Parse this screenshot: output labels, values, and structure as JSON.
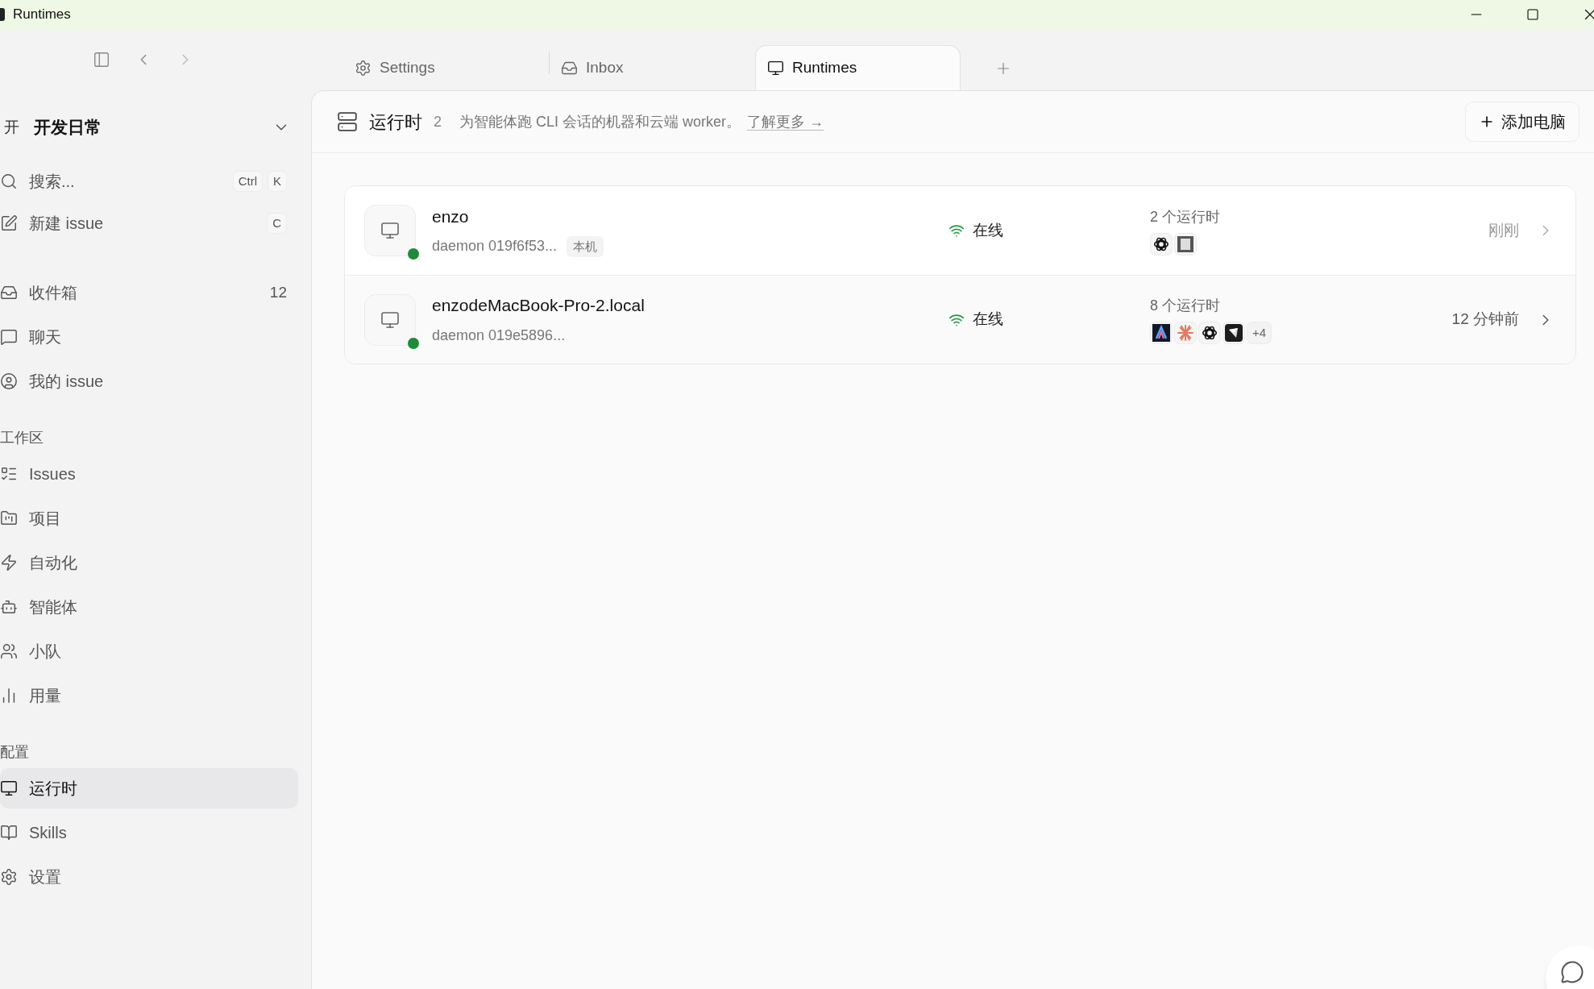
{
  "window": {
    "title": "Runtimes"
  },
  "tabs": [
    {
      "label": "Settings",
      "selected": false
    },
    {
      "label": "Inbox",
      "selected": false
    },
    {
      "label": "Runtimes",
      "selected": true
    }
  ],
  "sidebar": {
    "workspace": {
      "initial": "开",
      "name": "开发日常"
    },
    "quick": [
      {
        "label": "搜索...",
        "keys": [
          "Ctrl",
          "K"
        ]
      },
      {
        "label": "新建 issue",
        "keys": [
          "C"
        ]
      }
    ],
    "personal": [
      {
        "label": "收件箱",
        "count": "12",
        "selected": false
      },
      {
        "label": "聊天",
        "selected": false
      },
      {
        "label": "我的 issue",
        "selected": false
      }
    ],
    "sections": [
      {
        "title": "工作区",
        "items": [
          {
            "label": "Issues",
            "selected": false
          },
          {
            "label": "项目",
            "selected": false
          },
          {
            "label": "自动化",
            "selected": false
          },
          {
            "label": "智能体",
            "selected": false
          },
          {
            "label": "小队",
            "selected": false
          },
          {
            "label": "用量",
            "selected": false
          }
        ]
      },
      {
        "title": "配置",
        "items": [
          {
            "label": "运行时",
            "selected": true
          },
          {
            "label": "Skills",
            "selected": false
          },
          {
            "label": "设置",
            "selected": false
          }
        ]
      }
    ]
  },
  "header": {
    "title": "运行时",
    "count": "2",
    "description": "为智能体跑 CLI 会话的机器和云端 worker。",
    "link": "了解更多 →",
    "button": "添加电脑"
  },
  "machines": [
    {
      "name": "enzo",
      "daemon": "daemon 019f6f53...",
      "tag": "本机",
      "online": true,
      "status": "在线",
      "runtimes_count": "2 个运行时",
      "runtimes": [
        {
          "kind": "knot"
        },
        {
          "kind": "block"
        }
      ],
      "last_seen": "刚刚",
      "hovered": false
    },
    {
      "name": "enzodeMacBook-Pro-2.local",
      "daemon": "daemon 019e5896...",
      "online": true,
      "status": "在线",
      "runtimes_count": "8 个运行时",
      "runtimes": [
        {
          "kind": "peak"
        },
        {
          "kind": "burst"
        },
        {
          "kind": "knot"
        },
        {
          "kind": "cube"
        }
      ],
      "more": "+4",
      "last_seen": "12 分钟前",
      "hovered": true
    }
  ]
}
